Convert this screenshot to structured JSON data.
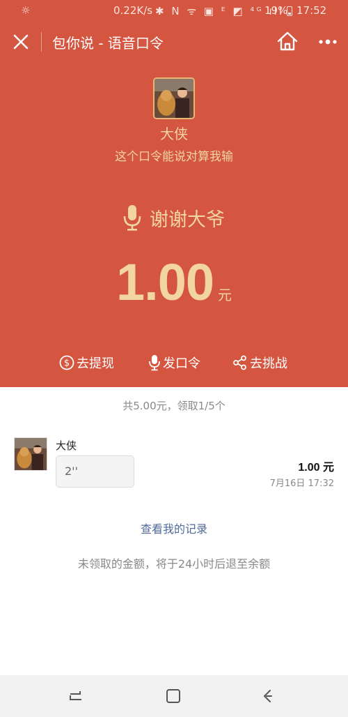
{
  "status_bar": {
    "network_speed": "0.22K/s",
    "icons_text": "✱ N ᯤ ▣ ᴱ ◩ ⁴ᴳ ıll",
    "battery_pct": "19%",
    "time": "17:52"
  },
  "header": {
    "title": "包你说 - 语音口令"
  },
  "sender": {
    "name": "大侠",
    "message": "这个口令能说对算我输"
  },
  "phrase": "谢谢大爷",
  "amount": {
    "value": "1.00",
    "unit": "元"
  },
  "actions": {
    "withdraw": "去提现",
    "send": "发口令",
    "challenge": "去挑战"
  },
  "summary": "共5.00元，领取1/5个",
  "records": [
    {
      "name": "大侠",
      "voice_duration": "2''",
      "amount": "1.00 元",
      "time": "7月16日 17:32"
    }
  ],
  "view_records": "查看我的记录",
  "expire_note": "未领取的金额，将于24小时后退至余额",
  "colors": {
    "red_bg": "#d45540",
    "gold_text": "#f2d5a3",
    "link_blue": "#506b9a"
  },
  "icons": [
    "close-icon",
    "home-icon",
    "more-icon",
    "microphone-icon",
    "dollar-icon",
    "share-icon"
  ]
}
